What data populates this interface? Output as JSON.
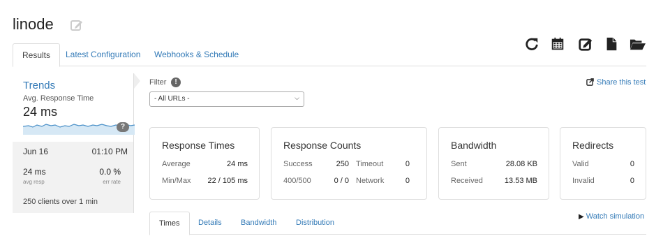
{
  "page": {
    "title": "linode"
  },
  "toolbar": {
    "icons": [
      "refresh-icon",
      "calendar-icon",
      "edit-icon",
      "document-icon",
      "folder-open-icon"
    ]
  },
  "tabs": [
    {
      "label": "Results",
      "active": true
    },
    {
      "label": "Latest Configuration",
      "active": false
    },
    {
      "label": "Webhooks & Schedule",
      "active": false
    }
  ],
  "trends": {
    "title": "Trends",
    "metric_label": "Avg. Response Time",
    "metric_value": "24 ms",
    "help_badge": "?",
    "date": "Jun 16",
    "time": "01:10 PM",
    "avg_resp_value": "24 ms",
    "avg_resp_label": "avg resp",
    "err_rate_value": "0.0 %",
    "err_rate_label": "err rate",
    "clients": "250 clients over 1 min"
  },
  "filter": {
    "label": "Filter",
    "info_badge": "!",
    "selected": "- All URLs -"
  },
  "share": {
    "label": "Share this test"
  },
  "cards": {
    "response_times": {
      "title": "Response Times",
      "rows": [
        {
          "label": "Average",
          "value": "24 ms"
        },
        {
          "label": "Min/Max",
          "value": "22 / 105 ms"
        }
      ]
    },
    "response_counts": {
      "title": "Response Counts",
      "rows": [
        {
          "label": "Success",
          "value": "250",
          "label2": "Timeout",
          "value2": "0"
        },
        {
          "label": "400/500",
          "value": "0 / 0",
          "label2": "Network",
          "value2": "0"
        }
      ]
    },
    "bandwidth": {
      "title": "Bandwidth",
      "rows": [
        {
          "label": "Sent",
          "value": "28.08 KB"
        },
        {
          "label": "Received",
          "value": "13.53 MB"
        }
      ]
    },
    "redirects": {
      "title": "Redirects",
      "rows": [
        {
          "label": "Valid",
          "value": "0"
        },
        {
          "label": "Invalid",
          "value": "0"
        }
      ]
    }
  },
  "bottom_tabs": [
    {
      "label": "Times",
      "active": true
    },
    {
      "label": "Details",
      "active": false
    },
    {
      "label": "Bandwidth",
      "active": false
    },
    {
      "label": "Distribution",
      "active": false
    }
  ],
  "watch": {
    "label": "Watch simulation"
  },
  "colors": {
    "link": "#337ab7",
    "sparkline": "#4a90c8",
    "border": "#dddddd"
  }
}
